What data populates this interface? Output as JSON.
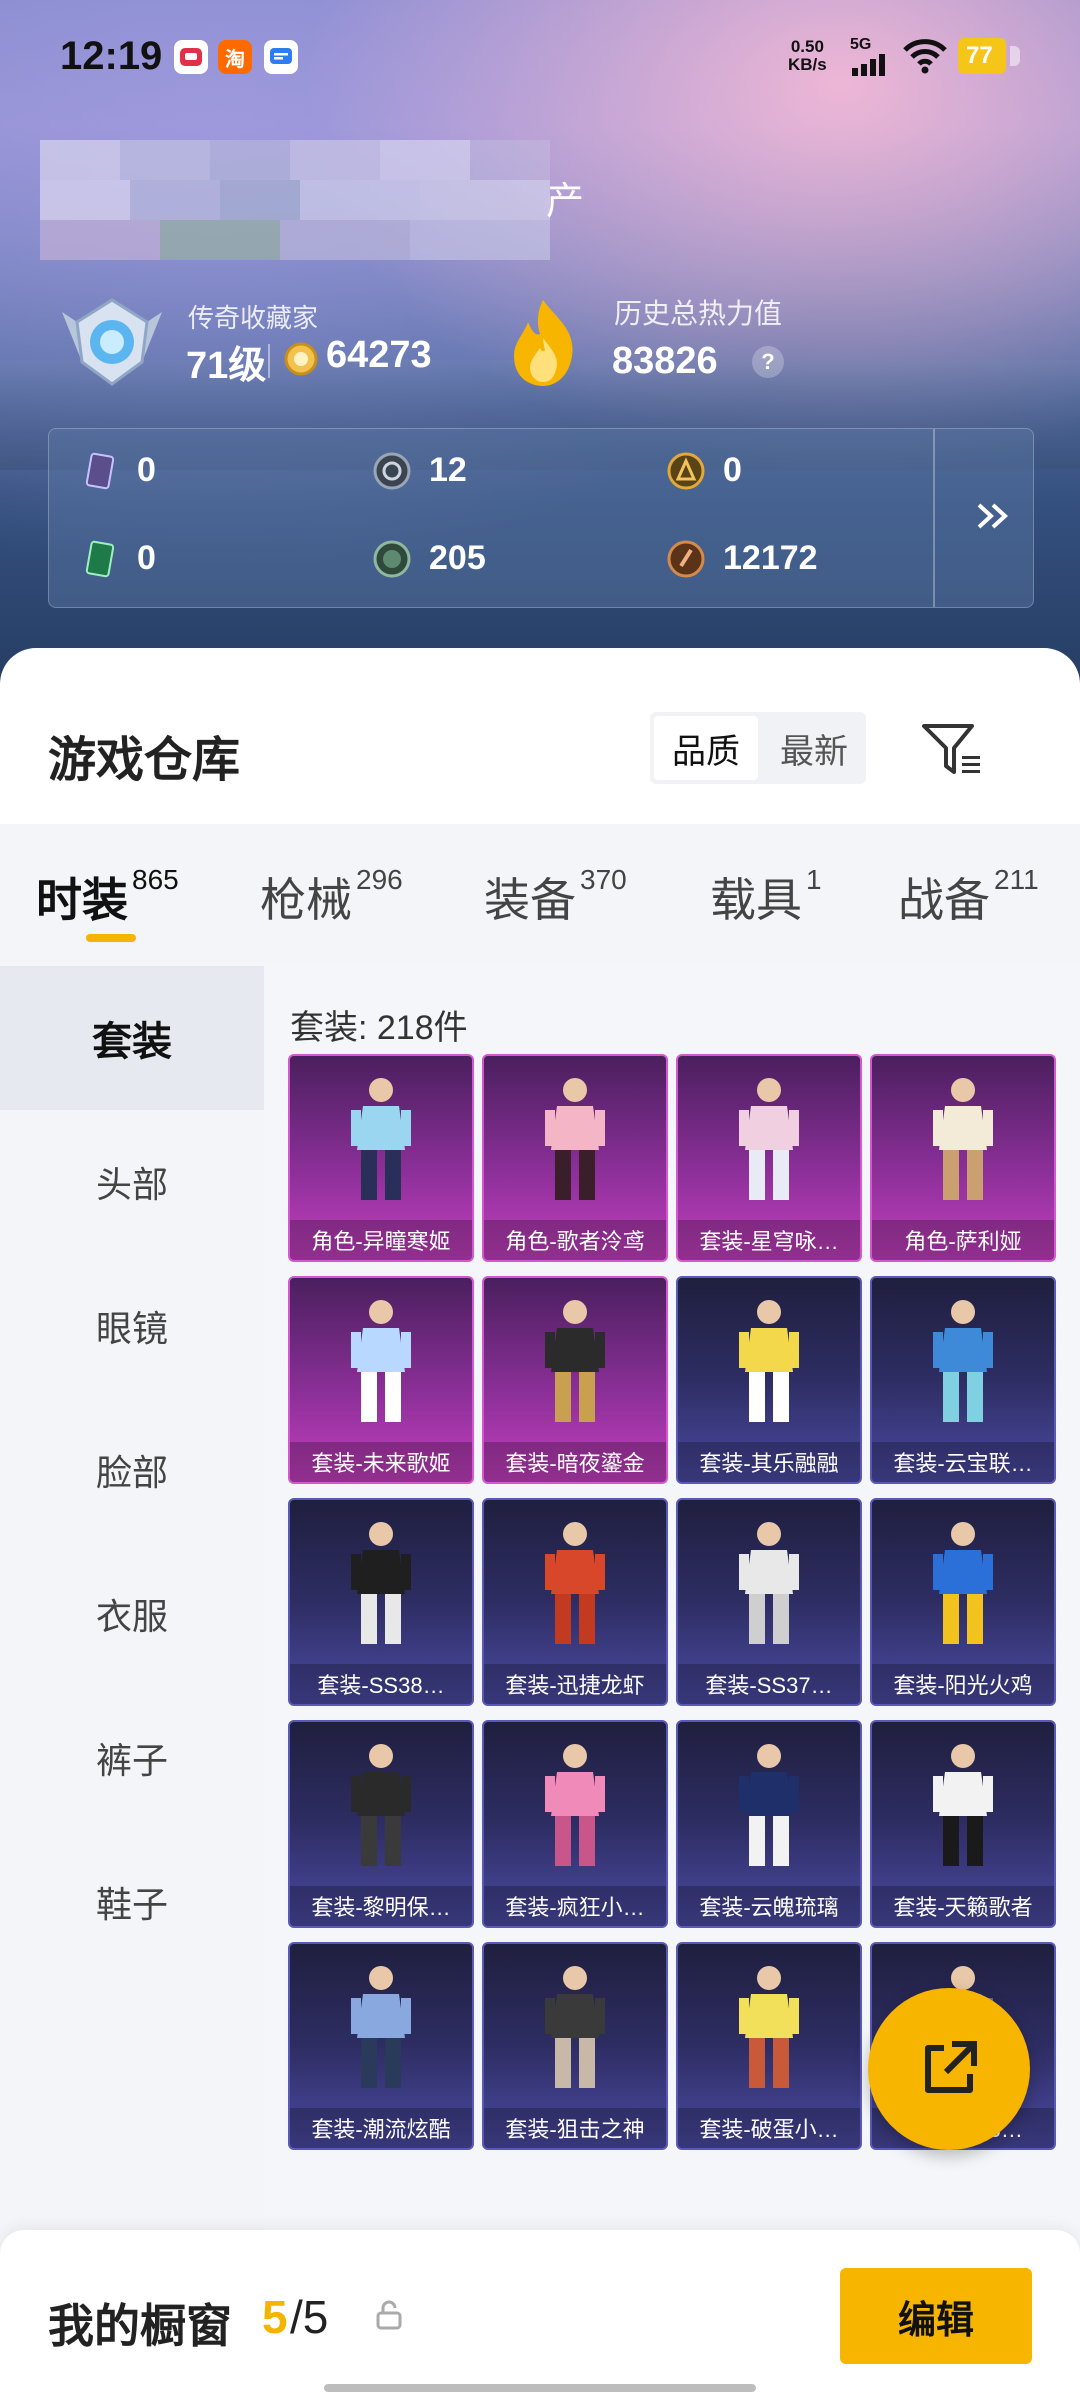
{
  "status_bar": {
    "time": "12:19",
    "net_speed_value": "0.50",
    "net_speed_unit": "KB/s",
    "network": "5G",
    "battery": "77",
    "app_icons": [
      "xiaohongshu-icon",
      "taobao-icon",
      "message-icon"
    ],
    "taobao_glyph": "淘"
  },
  "profile": {
    "name_visible_suffix": "产",
    "rank_title": "传奇收藏家",
    "level": "71级",
    "coins": "64273",
    "heat_title": "历史总热力值",
    "heat_value": "83826",
    "help_glyph": "?"
  },
  "stats": [
    {
      "icon": "card-icon",
      "value": "0"
    },
    {
      "icon": "silver-coin-icon",
      "value": "12"
    },
    {
      "icon": "gold-coin-icon",
      "value": "0"
    },
    {
      "icon": "green-card-icon",
      "value": "0"
    },
    {
      "icon": "green-coin-icon",
      "value": "205"
    },
    {
      "icon": "bronze-coin-icon",
      "value": "12172"
    }
  ],
  "warehouse": {
    "title": "游戏仓库",
    "sort_options": [
      "品质",
      "最新"
    ],
    "sort_selected": "品质"
  },
  "tabs": [
    {
      "label": "时装",
      "count": "865"
    },
    {
      "label": "枪械",
      "count": "296"
    },
    {
      "label": "装备",
      "count": "370"
    },
    {
      "label": "载具",
      "count": "1"
    },
    {
      "label": "战备",
      "count": "211"
    }
  ],
  "sidebar": [
    "套装",
    "头部",
    "眼镜",
    "脸部",
    "衣服",
    "裤子",
    "鞋子"
  ],
  "content": {
    "count_line": "套装: 218件",
    "items": [
      {
        "label": "角色-异瞳寒姬",
        "tier": "purple"
      },
      {
        "label": "角色-歌者泠鸢",
        "tier": "purple"
      },
      {
        "label": "套装-星穹咏…",
        "tier": "purple"
      },
      {
        "label": "角色-萨利娅",
        "tier": "purple"
      },
      {
        "label": "套装-未来歌姬",
        "tier": "purple"
      },
      {
        "label": "套装-暗夜鎏金",
        "tier": "purple"
      },
      {
        "label": "套装-其乐融融",
        "tier": "blue"
      },
      {
        "label": "套装-云宝联…",
        "tier": "blue"
      },
      {
        "label": "套装-SS38…",
        "tier": "blue"
      },
      {
        "label": "套装-迅捷龙虾",
        "tier": "blue"
      },
      {
        "label": "套装-SS37…",
        "tier": "blue"
      },
      {
        "label": "套装-阳光火鸡",
        "tier": "blue"
      },
      {
        "label": "套装-黎明保…",
        "tier": "blue"
      },
      {
        "label": "套装-疯狂小…",
        "tier": "blue"
      },
      {
        "label": "套装-云魄琉璃",
        "tier": "blue"
      },
      {
        "label": "套装-天籁歌者",
        "tier": "blue"
      },
      {
        "label": "套装-潮流炫酷",
        "tier": "blue"
      },
      {
        "label": "套装-狙击之神",
        "tier": "blue"
      },
      {
        "label": "套装-破蛋小…",
        "tier": "blue"
      },
      {
        "label": "套…SS36…",
        "tier": "blue"
      }
    ]
  },
  "bottom_bar": {
    "showcase_label": "我的橱窗",
    "showcase_used": "5",
    "showcase_total": "/5",
    "edit_label": "编辑"
  },
  "colors": {
    "accent": "#f7b500",
    "purple_tier": "#c43fbf",
    "blue_tier": "#4b4aa3"
  }
}
